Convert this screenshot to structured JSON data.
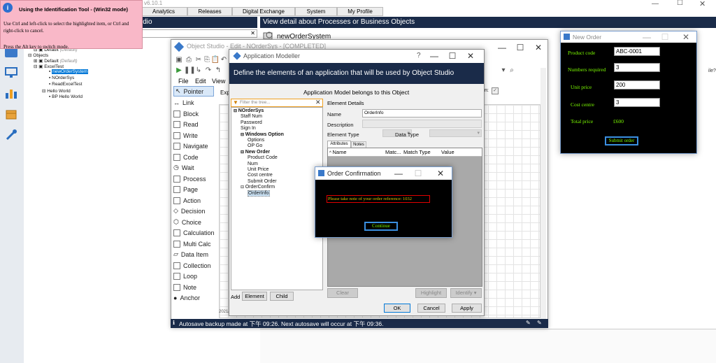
{
  "main_app": {
    "version": "v6.10.1",
    "tabs": [
      "Analytics",
      "Releases",
      "Digital Exchange",
      "System",
      "My Profile"
    ],
    "left_header_text": "idio",
    "view_detail_header": "View detail about Processes or Business Objects",
    "selected_object_name": "newOrderSystem",
    "tree": [
      {
        "label": "Default",
        "suffix": "(Default)"
      },
      {
        "label": "Objects",
        "suffix": ""
      },
      {
        "label": "Default",
        "suffix": "(Default)"
      },
      {
        "label": "ExcelTest",
        "suffix": ""
      },
      {
        "label": "newOrderSystem",
        "suffix": ""
      },
      {
        "label": "NOrderSys",
        "suffix": ""
      },
      {
        "label": "ReadExcelTest",
        "suffix": ""
      },
      {
        "label": "Hello World",
        "suffix": ""
      },
      {
        "label": "BP Hello World",
        "suffix": ""
      }
    ],
    "side_label_right": "ile?"
  },
  "tooltip": {
    "title": "Using the Identification Tool - (Win32 mode)",
    "line1": "Use Ctrl and left-click to select the highlighted item, or Ctrl and right-click to cancel.",
    "line2": "Press the Alt key to switch mode."
  },
  "object_studio": {
    "title": "Object Studio  - Edit - NOrderSys - [COMPLETED]",
    "menu": [
      "File",
      "Edit",
      "View"
    ],
    "expr_label": "Expr",
    "palette": [
      "Pointer",
      "Link",
      "Block",
      "Read",
      "Write",
      "Navigate",
      "Code",
      "Wait",
      "Process",
      "Page",
      "Action",
      "Decision",
      "Choice",
      "Calculation",
      "Multi Calc",
      "Data Item",
      "Collection",
      "Loop",
      "Note",
      "Anchor"
    ],
    "year_text": "2021/",
    "status_bar": "Autosave backup made at 下午 09:26. Next autosave will occur at 下午 09:36."
  },
  "app_modeller": {
    "title": "Application Modeller",
    "help": "?",
    "header": "Define the elements of an application that will be used by Object Studio",
    "belongs_text": "Application Model belongs to this Object",
    "belongs_right_label": "n:",
    "filter_placeholder": "Filter the tree...",
    "tree": [
      {
        "label": "NOrderSys",
        "level": 0,
        "bold": true,
        "toggle": "−"
      },
      {
        "label": "Staff Num",
        "level": 1,
        "bold": false,
        "toggle": ""
      },
      {
        "label": "Password",
        "level": 1,
        "bold": false,
        "toggle": ""
      },
      {
        "label": "Sign In",
        "level": 1,
        "bold": false,
        "toggle": ""
      },
      {
        "label": "Windows Option",
        "level": 1,
        "bold": true,
        "toggle": "−"
      },
      {
        "label": "Options",
        "level": 2,
        "bold": false,
        "toggle": ""
      },
      {
        "label": "OP Go",
        "level": 2,
        "bold": false,
        "toggle": ""
      },
      {
        "label": "New Order",
        "level": 1,
        "bold": true,
        "toggle": "−"
      },
      {
        "label": "Product Code",
        "level": 2,
        "bold": false,
        "toggle": ""
      },
      {
        "label": "Num",
        "level": 2,
        "bold": false,
        "toggle": ""
      },
      {
        "label": "Unit Price",
        "level": 2,
        "bold": false,
        "toggle": ""
      },
      {
        "label": "Cost centre",
        "level": 2,
        "bold": false,
        "toggle": ""
      },
      {
        "label": "Submit Order",
        "level": 2,
        "bold": false,
        "toggle": ""
      },
      {
        "label": "OrderConfirm",
        "level": 1,
        "bold": false,
        "toggle": "−"
      },
      {
        "label": "OrderInfo",
        "level": 2,
        "bold": false,
        "toggle": ""
      }
    ],
    "add_label": "Add",
    "element_btn": "Element",
    "child_btn": "Child",
    "element_details": "Element Details",
    "name_label": "Name",
    "name_value": "OrderInfo",
    "description_label": "Description",
    "element_type_label": "Element Type",
    "data_type_label": "Data Type",
    "tab_attributes": "Attributes",
    "tab_notes": "Notes",
    "columns": [
      "Name",
      "Matc...",
      "Match Type",
      "Value"
    ],
    "clear_btn": "Clear",
    "highlight_btn": "Highlight",
    "identify_btn": "Identify",
    "ok_btn": "OK",
    "cancel_btn": "Cancel",
    "apply_btn": "Apply"
  },
  "order_confirmation": {
    "title": "Order Confirmation",
    "message": "Please take note of your order reference: 1032",
    "continue_btn": "Continue"
  },
  "new_order": {
    "title": "New Order",
    "product_code_label": "Product code",
    "product_code_value": "ABC-0001",
    "numbers_required_label": "Numbers required",
    "numbers_required_value": "3",
    "unit_price_label": "Unit price",
    "unit_price_value": "200",
    "cost_centre_label": "Cost centre",
    "cost_centre_value": "3",
    "total_price_label": "Total price",
    "total_price_value": "£600",
    "submit_btn": "Submit order"
  },
  "colors": {
    "navy": "#1a2b49",
    "tooltip_bg": "#f9b8c8",
    "green_text": "#7cfc00",
    "selection": "#0078d7"
  }
}
